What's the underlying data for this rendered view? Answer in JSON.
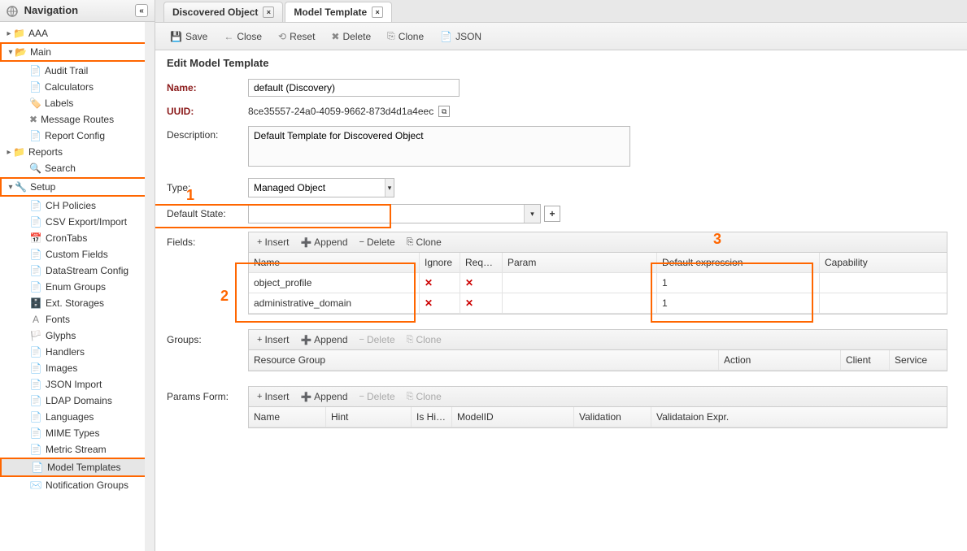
{
  "sidebar": {
    "title": "Navigation",
    "tree": {
      "aaa": "AAA",
      "main": "Main",
      "main_items": [
        "Audit Trail",
        "Calculators",
        "Labels",
        "Message Routes",
        "Report Config"
      ],
      "reports": "Reports",
      "search": "Search",
      "setup": "Setup",
      "setup_items": [
        "CH Policies",
        "CSV Export/Import",
        "CronTabs",
        "Custom Fields",
        "DataStream Config",
        "Enum Groups",
        "Ext. Storages",
        "Fonts",
        "Glyphs",
        "Handlers",
        "Images",
        "JSON Import",
        "LDAP Domains",
        "Languages",
        "MIME Types",
        "Metric Stream",
        "Model Templates",
        "Notification Groups"
      ]
    }
  },
  "tabs": {
    "t1": "Discovered Object",
    "t2": "Model Template"
  },
  "toolbar": {
    "save": "Save",
    "close": "Close",
    "reset": "Reset",
    "delete": "Delete",
    "clone": "Clone",
    "json": "JSON"
  },
  "form": {
    "heading": "Edit Model Template",
    "name_label": "Name:",
    "name_value": "default (Discovery)",
    "uuid_label": "UUID:",
    "uuid_value": "8ce35557-24a0-4059-9662-873d4d1a4eec",
    "desc_label": "Description:",
    "desc_value": "Default Template for Discovered Object",
    "type_label": "Type:",
    "type_value": "Managed Object",
    "defstate_label": "Default State:",
    "defstate_value": "",
    "fields_label": "Fields:",
    "groups_label": "Groups:",
    "params_label": "Params Form:"
  },
  "grids": {
    "toolbar": {
      "insert": "Insert",
      "append": "Append",
      "delete": "Delete",
      "clone": "Clone"
    },
    "fields": {
      "headers": {
        "name": "Name",
        "ignore": "Ignore",
        "required": "Requi...",
        "param": "Param",
        "def": "Default expression",
        "cap": "Capability"
      },
      "rows": [
        {
          "name": "object_profile",
          "ignore": "✕",
          "required": "✕",
          "param": "",
          "def": "1",
          "cap": ""
        },
        {
          "name": "administrative_domain",
          "ignore": "✕",
          "required": "✕",
          "param": "",
          "def": "1",
          "cap": ""
        }
      ]
    },
    "groups": {
      "headers": {
        "rg": "Resource Group",
        "act": "Action",
        "cli": "Client",
        "svc": "Service"
      }
    },
    "params": {
      "headers": {
        "name": "Name",
        "hint": "Hint",
        "hide": "Is Hide",
        "model": "ModelID",
        "valid": "Validation",
        "vexp": "Validataion Expr."
      }
    }
  },
  "annot": {
    "m1": "1",
    "m2": "2",
    "m3": "3"
  },
  "chart_data": null
}
